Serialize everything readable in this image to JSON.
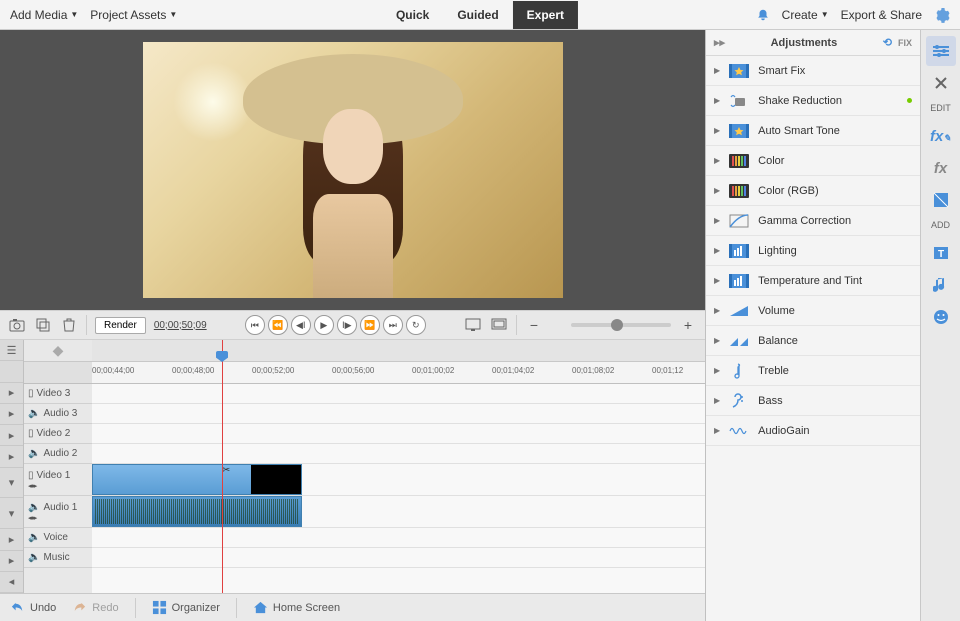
{
  "topbar": {
    "add_media": "Add Media",
    "project_assets": "Project Assets",
    "modes": [
      "Quick",
      "Guided",
      "Expert"
    ],
    "active_mode": "Expert",
    "create": "Create",
    "export_share": "Export & Share"
  },
  "controls": {
    "render": "Render",
    "timecode": "00;00;50;09"
  },
  "ruler_ticks": [
    {
      "pos": 0,
      "label": "00;00;44;00"
    },
    {
      "pos": 80,
      "label": "00;00;48;00"
    },
    {
      "pos": 160,
      "label": "00;00;52;00"
    },
    {
      "pos": 240,
      "label": "00;00;56;00"
    },
    {
      "pos": 320,
      "label": "00;01;00;02"
    },
    {
      "pos": 400,
      "label": "00;01;04;02"
    },
    {
      "pos": 480,
      "label": "00;01;08;02"
    },
    {
      "pos": 560,
      "label": "00;01;12"
    }
  ],
  "tracks": [
    {
      "name": "Video 3",
      "icon": "film",
      "tall": false
    },
    {
      "name": "Audio 3",
      "icon": "sound",
      "tall": false
    },
    {
      "name": "Video 2",
      "icon": "film",
      "tall": false
    },
    {
      "name": "Audio 2",
      "icon": "sound",
      "tall": false
    },
    {
      "name": "Video 1",
      "icon": "film",
      "tall": true
    },
    {
      "name": "Audio 1",
      "icon": "sound",
      "tall": true
    },
    {
      "name": "Voice",
      "icon": "sound",
      "tall": false
    },
    {
      "name": "Music",
      "icon": "sound",
      "tall": false
    }
  ],
  "bottom": {
    "undo": "Undo",
    "redo": "Redo",
    "organizer": "Organizer",
    "home": "Home Screen"
  },
  "adjustments": {
    "title": "Adjustments",
    "fix": "FIX",
    "items": [
      {
        "label": "Smart Fix",
        "icon": "film-star"
      },
      {
        "label": "Shake Reduction",
        "icon": "shake",
        "dot": true
      },
      {
        "label": "Auto Smart Tone",
        "icon": "film-star"
      },
      {
        "label": "Color",
        "icon": "bars"
      },
      {
        "label": "Color (RGB)",
        "icon": "bars"
      },
      {
        "label": "Gamma Correction",
        "icon": "curve"
      },
      {
        "label": "Lighting",
        "icon": "film-bars"
      },
      {
        "label": "Temperature and Tint",
        "icon": "film-bars"
      },
      {
        "label": "Volume",
        "icon": "vol"
      },
      {
        "label": "Balance",
        "icon": "bal"
      },
      {
        "label": "Treble",
        "icon": "treble"
      },
      {
        "label": "Bass",
        "icon": "bass"
      },
      {
        "label": "AudioGain",
        "icon": "gain"
      }
    ]
  },
  "right_toolbar": {
    "edit": "EDIT",
    "add": "ADD"
  }
}
